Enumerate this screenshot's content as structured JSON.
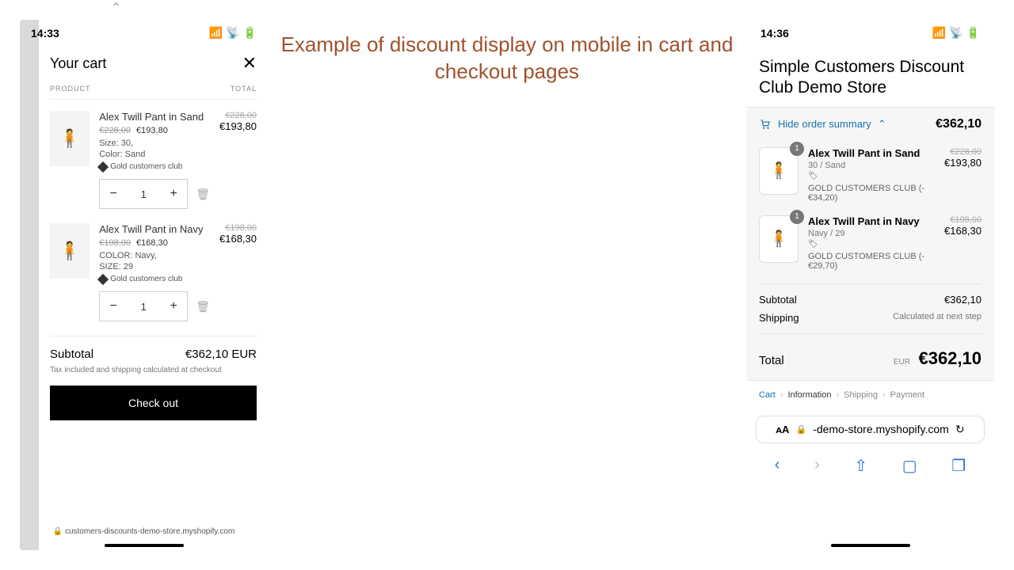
{
  "caption": "Example of discount display on mobile in cart and checkout pages",
  "left": {
    "time": "14:33",
    "cart_title": "Your cart",
    "col_product": "PRODUCT",
    "col_total": "TOTAL",
    "items": [
      {
        "name": "Alex Twill Pant in Sand",
        "old_price": "€228,00",
        "new_price": "€193,80",
        "line_old": "€228,00",
        "line_new": "€193,80",
        "meta1": "Size: 30,",
        "meta2": "Color: Sand",
        "tag": "Gold customers club",
        "qty": "1"
      },
      {
        "name": "Alex Twill Pant in Navy",
        "old_price": "€198,00",
        "new_price": "€168,30",
        "line_old": "€198,00",
        "line_new": "€168,30",
        "meta1": "COLOR: Navy,",
        "meta2": "SIZE: 29",
        "tag": "Gold customers club",
        "qty": "1"
      }
    ],
    "subtotal_label": "Subtotal",
    "subtotal_value": "€362,10 EUR",
    "tax_note": "Tax included and shipping calculated at checkout",
    "checkout": "Check out",
    "url": "customers-discounts-demo-store.myshopify.com"
  },
  "right": {
    "time": "14:36",
    "store_title": "Simple Customers Discount Club Demo Store",
    "hide_summary": "Hide order summary",
    "summary_total": "€362,10",
    "items": [
      {
        "name": "Alex Twill Pant in Sand",
        "variant": "30 / Sand",
        "discount": "GOLD CUSTOMERS CLUB (-€34,20)",
        "old_price": "€228,00",
        "new_price": "€193,80",
        "qty": "1"
      },
      {
        "name": "Alex Twill Pant in Navy",
        "variant": "Navy / 29",
        "discount": "GOLD CUSTOMERS CLUB (-€29,70)",
        "old_price": "€198,00",
        "new_price": "€168,30",
        "qty": "1"
      }
    ],
    "subtotal_label": "Subtotal",
    "subtotal_value": "€362,10",
    "shipping_label": "Shipping",
    "shipping_value": "Calculated at next step",
    "total_label": "Total",
    "total_currency": "EUR",
    "total_value": "€362,10",
    "breadcrumbs": {
      "cart": "Cart",
      "information": "Information",
      "shipping": "Shipping",
      "payment": "Payment"
    },
    "url": "-demo-store.myshopify.com"
  }
}
